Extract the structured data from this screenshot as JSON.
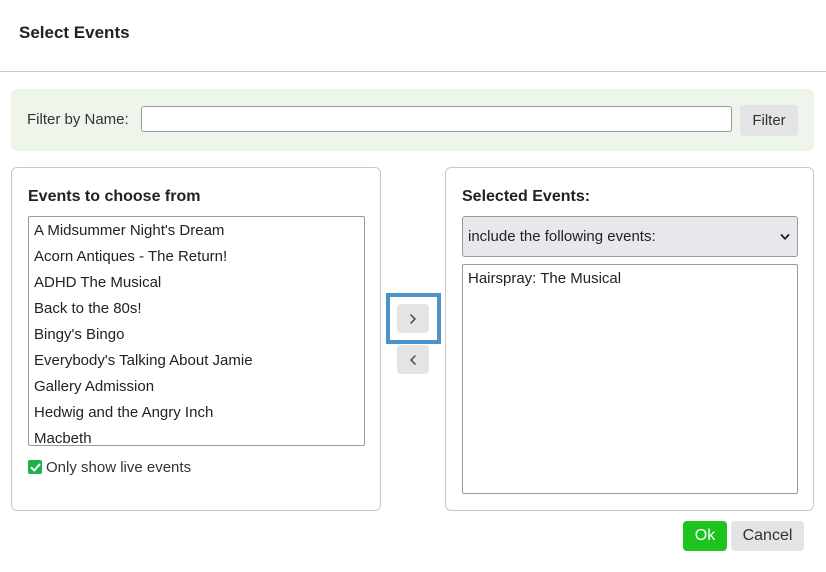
{
  "dialog": {
    "title": "Select Events"
  },
  "filter": {
    "label": "Filter by Name:",
    "value": "",
    "placeholder": "",
    "button_label": "Filter"
  },
  "available": {
    "title": "Events to choose from",
    "items": [
      "A Midsummer Night's Dream",
      "Acorn Antiques - The Return!",
      "ADHD The Musical",
      "Back to the 80s!",
      "Bingy's Bingo",
      "Everybody's Talking About Jamie",
      "Gallery Admission",
      "Hedwig and the Angry Inch",
      "Macbeth"
    ],
    "live_only_label": "Only show live events",
    "live_only_checked": true
  },
  "selected": {
    "title": "Selected Events:",
    "mode_selected": "include the following events:",
    "items": [
      "Hairspray: The Musical"
    ]
  },
  "icons": {
    "move_right": "chevron-right-icon",
    "move_left": "chevron-left-icon",
    "select": "chevron-down-icon",
    "check": "check-icon"
  },
  "colors": {
    "filter_bg": "#eef6ec",
    "ok": "#1ec31e",
    "checkbox": "#22b04b",
    "focus_frame": "#4c93c8"
  },
  "footer": {
    "ok_label": "Ok",
    "cancel_label": "Cancel"
  }
}
